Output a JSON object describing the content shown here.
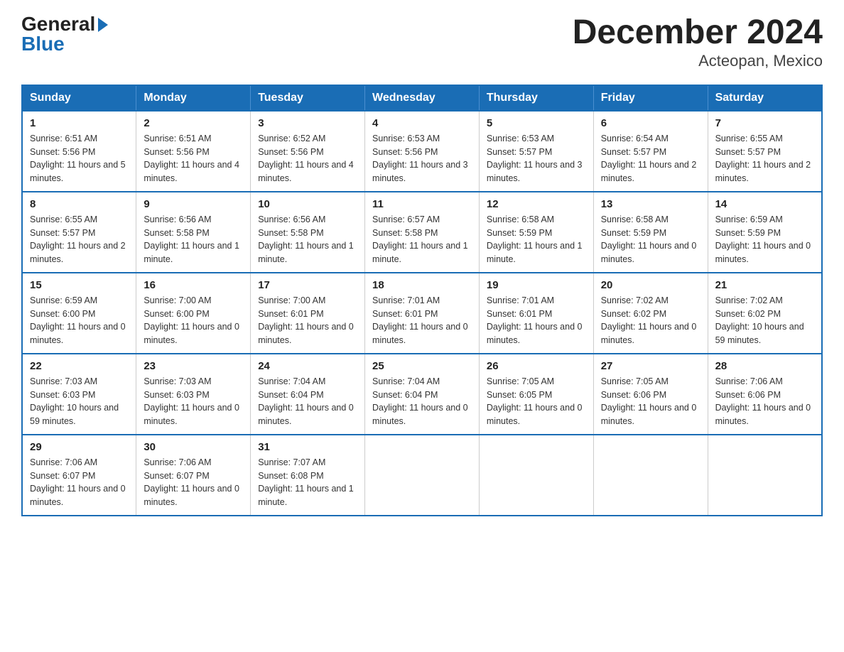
{
  "logo": {
    "general": "General",
    "blue": "Blue",
    "arrow": "▶"
  },
  "title": "December 2024",
  "subtitle": "Acteopan, Mexico",
  "calendar": {
    "headers": [
      "Sunday",
      "Monday",
      "Tuesday",
      "Wednesday",
      "Thursday",
      "Friday",
      "Saturday"
    ],
    "weeks": [
      [
        {
          "day": "1",
          "sunrise": "6:51 AM",
          "sunset": "5:56 PM",
          "daylight": "11 hours and 5 minutes."
        },
        {
          "day": "2",
          "sunrise": "6:51 AM",
          "sunset": "5:56 PM",
          "daylight": "11 hours and 4 minutes."
        },
        {
          "day": "3",
          "sunrise": "6:52 AM",
          "sunset": "5:56 PM",
          "daylight": "11 hours and 4 minutes."
        },
        {
          "day": "4",
          "sunrise": "6:53 AM",
          "sunset": "5:56 PM",
          "daylight": "11 hours and 3 minutes."
        },
        {
          "day": "5",
          "sunrise": "6:53 AM",
          "sunset": "5:57 PM",
          "daylight": "11 hours and 3 minutes."
        },
        {
          "day": "6",
          "sunrise": "6:54 AM",
          "sunset": "5:57 PM",
          "daylight": "11 hours and 2 minutes."
        },
        {
          "day": "7",
          "sunrise": "6:55 AM",
          "sunset": "5:57 PM",
          "daylight": "11 hours and 2 minutes."
        }
      ],
      [
        {
          "day": "8",
          "sunrise": "6:55 AM",
          "sunset": "5:57 PM",
          "daylight": "11 hours and 2 minutes."
        },
        {
          "day": "9",
          "sunrise": "6:56 AM",
          "sunset": "5:58 PM",
          "daylight": "11 hours and 1 minute."
        },
        {
          "day": "10",
          "sunrise": "6:56 AM",
          "sunset": "5:58 PM",
          "daylight": "11 hours and 1 minute."
        },
        {
          "day": "11",
          "sunrise": "6:57 AM",
          "sunset": "5:58 PM",
          "daylight": "11 hours and 1 minute."
        },
        {
          "day": "12",
          "sunrise": "6:58 AM",
          "sunset": "5:59 PM",
          "daylight": "11 hours and 1 minute."
        },
        {
          "day": "13",
          "sunrise": "6:58 AM",
          "sunset": "5:59 PM",
          "daylight": "11 hours and 0 minutes."
        },
        {
          "day": "14",
          "sunrise": "6:59 AM",
          "sunset": "5:59 PM",
          "daylight": "11 hours and 0 minutes."
        }
      ],
      [
        {
          "day": "15",
          "sunrise": "6:59 AM",
          "sunset": "6:00 PM",
          "daylight": "11 hours and 0 minutes."
        },
        {
          "day": "16",
          "sunrise": "7:00 AM",
          "sunset": "6:00 PM",
          "daylight": "11 hours and 0 minutes."
        },
        {
          "day": "17",
          "sunrise": "7:00 AM",
          "sunset": "6:01 PM",
          "daylight": "11 hours and 0 minutes."
        },
        {
          "day": "18",
          "sunrise": "7:01 AM",
          "sunset": "6:01 PM",
          "daylight": "11 hours and 0 minutes."
        },
        {
          "day": "19",
          "sunrise": "7:01 AM",
          "sunset": "6:01 PM",
          "daylight": "11 hours and 0 minutes."
        },
        {
          "day": "20",
          "sunrise": "7:02 AM",
          "sunset": "6:02 PM",
          "daylight": "11 hours and 0 minutes."
        },
        {
          "day": "21",
          "sunrise": "7:02 AM",
          "sunset": "6:02 PM",
          "daylight": "10 hours and 59 minutes."
        }
      ],
      [
        {
          "day": "22",
          "sunrise": "7:03 AM",
          "sunset": "6:03 PM",
          "daylight": "10 hours and 59 minutes."
        },
        {
          "day": "23",
          "sunrise": "7:03 AM",
          "sunset": "6:03 PM",
          "daylight": "11 hours and 0 minutes."
        },
        {
          "day": "24",
          "sunrise": "7:04 AM",
          "sunset": "6:04 PM",
          "daylight": "11 hours and 0 minutes."
        },
        {
          "day": "25",
          "sunrise": "7:04 AM",
          "sunset": "6:04 PM",
          "daylight": "11 hours and 0 minutes."
        },
        {
          "day": "26",
          "sunrise": "7:05 AM",
          "sunset": "6:05 PM",
          "daylight": "11 hours and 0 minutes."
        },
        {
          "day": "27",
          "sunrise": "7:05 AM",
          "sunset": "6:06 PM",
          "daylight": "11 hours and 0 minutes."
        },
        {
          "day": "28",
          "sunrise": "7:06 AM",
          "sunset": "6:06 PM",
          "daylight": "11 hours and 0 minutes."
        }
      ],
      [
        {
          "day": "29",
          "sunrise": "7:06 AM",
          "sunset": "6:07 PM",
          "daylight": "11 hours and 0 minutes."
        },
        {
          "day": "30",
          "sunrise": "7:06 AM",
          "sunset": "6:07 PM",
          "daylight": "11 hours and 0 minutes."
        },
        {
          "day": "31",
          "sunrise": "7:07 AM",
          "sunset": "6:08 PM",
          "daylight": "11 hours and 1 minute."
        },
        null,
        null,
        null,
        null
      ]
    ]
  }
}
